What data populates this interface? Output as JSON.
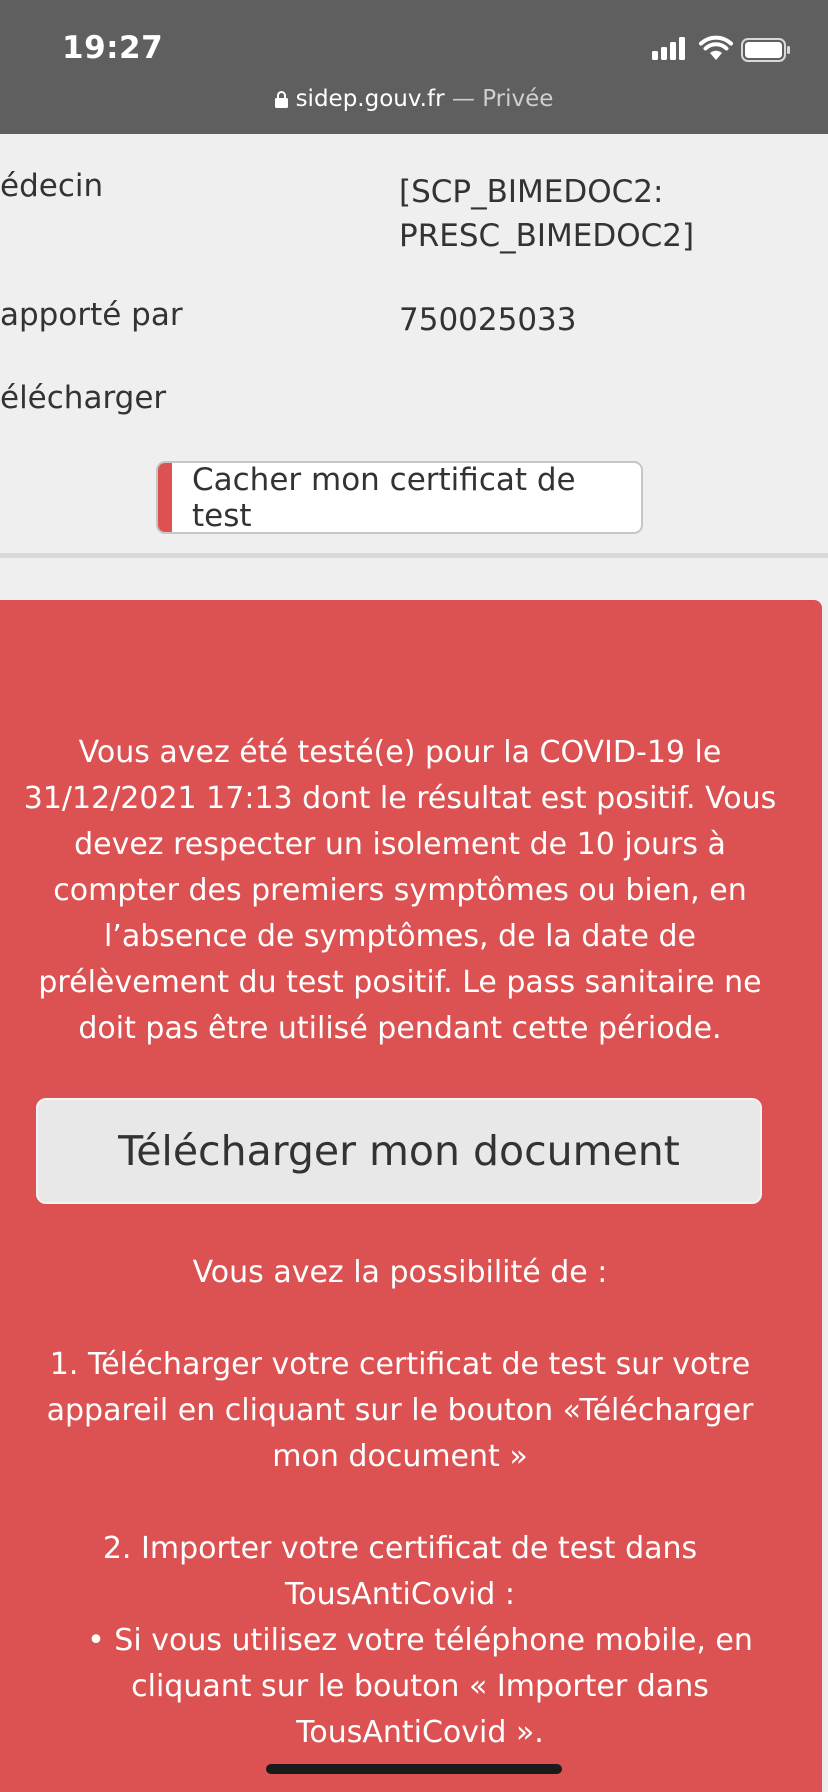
{
  "status_bar": {
    "time": "19:27",
    "signal_icon": "cellular-signal-icon",
    "wifi_icon": "wifi-icon",
    "battery_icon": "battery-icon"
  },
  "browser": {
    "lock_icon": "lock-icon",
    "domain": "sidep.gouv.fr",
    "separator": " — ",
    "mode": "Privée"
  },
  "details": {
    "rows": [
      {
        "label": "édecin",
        "value_line1": "[SCP_BIMEDOC2:",
        "value_line2": "PRESC_BIMEDOC2]"
      },
      {
        "label": "apporté par",
        "value_line1": "750025033"
      },
      {
        "label": "élécharger"
      }
    ],
    "hide_button_label": "Cacher mon certificat de test"
  },
  "result_panel": {
    "message": "Vous avez été testé(e) pour la COVID-19 le 31/12/2021 17:13 dont le résultat est positif. Vous devez respecter un isolement de 10 jours à compter des premiers symptômes ou bien, en l’absence de symptômes, de la date de prélèvement du test positif. Le pass sanitaire ne doit pas être utilisé pendant cette période.",
    "download_button_label": "Télécharger mon document",
    "options_intro": "Vous avez la possibilité de :",
    "option_1": "1. Télécharger votre certificat de test sur votre appareil en cliquant sur le bouton «Télécharger mon document »",
    "option_2_title": "2. Importer votre certificat de test dans TousAntiCovid :",
    "option_2_bullet": "• Si vous utilisez votre téléphone mobile, en cliquant sur le bouton « Importer dans TousAntiCovid »."
  },
  "colors": {
    "status_bar_bg": "#5f5f5f",
    "panel_red": "#dc5252",
    "page_bg": "#efefef"
  }
}
